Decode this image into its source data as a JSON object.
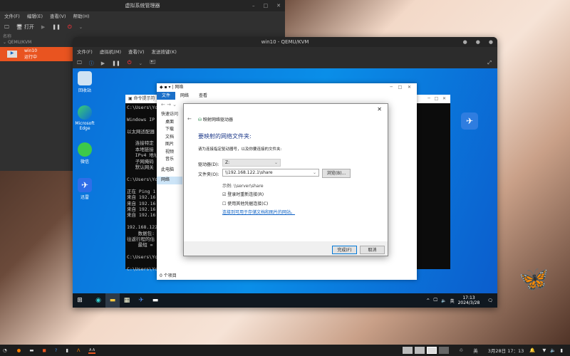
{
  "manager": {
    "title": "虚拟系统管理器",
    "menu": [
      "文件(F)",
      "编辑(E)",
      "查看(V)",
      "帮助(H)"
    ],
    "open_label": "打开",
    "column_name": "名称",
    "group": "QEMU/KVM",
    "vm": {
      "name": "win10",
      "status": "运行中"
    },
    "accent": "#e95420"
  },
  "qemu": {
    "title": "win10 - QEMU/KVM",
    "menu": [
      "文件(F)",
      "虚拟机(M)",
      "查看(V)",
      "发送按键(K)"
    ]
  },
  "guest": {
    "desktop_icons": [
      "回收站",
      "Microsoft Edge",
      "微信",
      "迅雷"
    ],
    "cmd": {
      "title": "命令提示符",
      "lines": [
        "C:\\Users\\Yo",
        "",
        "Windows IP",
        "",
        "以太网适配器",
        "",
        "   连接特定",
        "   本地链接",
        "   IPv4 地址",
        "   子网掩码",
        "   默认网关",
        "",
        "C:\\Users\\Yo",
        "",
        "正在 Ping 1",
        "来自 192.16",
        "来自 192.16",
        "来自 192.16",
        "来自 192.16",
        "",
        "192.168.122.",
        "    数据包:",
        "往返行程的估",
        "    最短 =",
        "",
        "C:\\Users\\Yo",
        "",
        "C:\\Users\\Yo"
      ]
    },
    "explorer": {
      "title": "网络",
      "ribbon": [
        "文件",
        "网络",
        "查看"
      ],
      "nav": [
        "快速访问",
        "桌面",
        "下载",
        "文档",
        "图片",
        "视频",
        "音乐",
        "此电脑",
        "网络"
      ],
      "status": "0 个项目"
    },
    "dialog": {
      "title": "映射网络驱动器",
      "heading": "要映射的网络文件夹:",
      "instruction": "请为连接指定驱动器号，以及你要连接的文件夹:",
      "drive_label": "驱动器(D):",
      "drive_value": "Z:",
      "folder_label": "文件夹(O):",
      "folder_value": "\\\\192.168.122.1\\share",
      "browse": "浏览(B)...",
      "example": "示例: \\\\server\\share",
      "reconnect": "登录时重新连接(R)",
      "reconnect_checked": true,
      "other_creds": "使用其他凭据连接(C)",
      "other_creds_checked": false,
      "link": "连接到可用于存储文档和图片的网站。",
      "finish": "完成(F)",
      "cancel": "取消"
    },
    "taskbar": {
      "ime": "英",
      "time": "17:13",
      "date": "2024/3/28"
    }
  },
  "host_taskbar": {
    "ime": "英",
    "datetime": "3月28日 17：13"
  }
}
